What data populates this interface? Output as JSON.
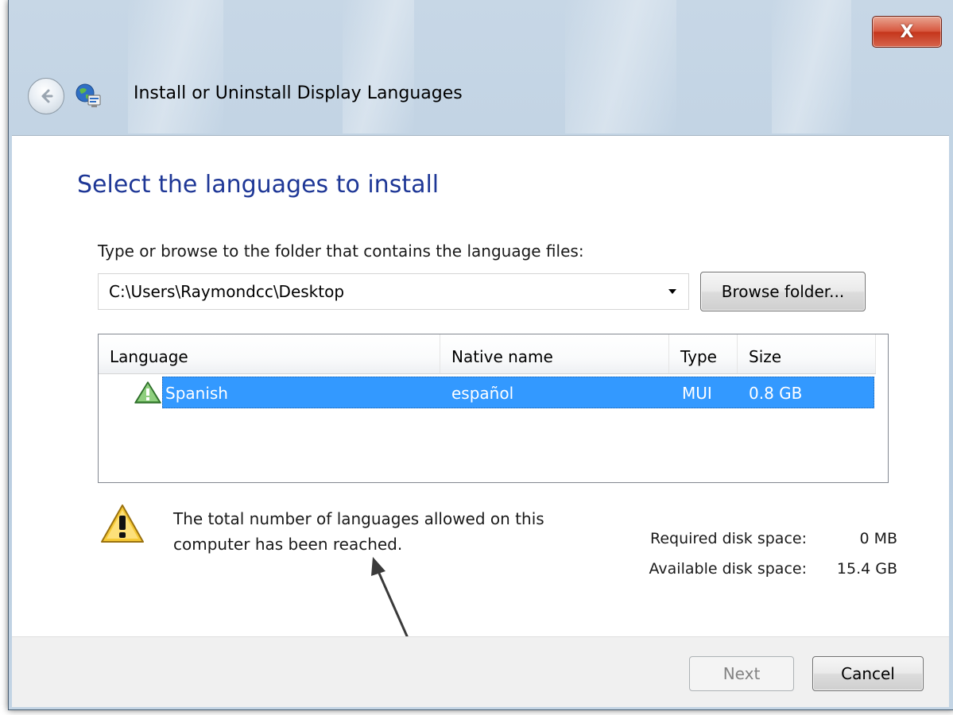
{
  "window": {
    "title": "Install or Uninstall Display Languages",
    "close_glyph": "X",
    "back_icon": "back-arrow-icon",
    "app_icon": "globe-language-icon"
  },
  "page": {
    "heading": "Select the languages to install",
    "folder_label": "Type or browse to the folder that contains the language files:",
    "folder_path": "C:\\Users\\Raymondcc\\Desktop",
    "browse_label": "Browse folder..."
  },
  "language_list": {
    "columns": [
      "Language",
      "Native name",
      "Type",
      "Size"
    ],
    "rows": [
      {
        "language": "Spanish",
        "native_name": "español",
        "type": "MUI",
        "size": "0.8 GB",
        "status_icon": "warning-icon",
        "selected": true
      }
    ]
  },
  "warning": {
    "icon": "warning-icon",
    "message": "The total number of languages allowed on this computer has been reached."
  },
  "disk": {
    "required_label": "Required disk space:",
    "required_value": "0 MB",
    "available_label": "Available disk space:",
    "available_value": "15.4 GB"
  },
  "footer": {
    "next_label": "Next",
    "next_enabled": false,
    "cancel_label": "Cancel"
  },
  "colors": {
    "heading": "#1e3796",
    "selection": "#3399ff",
    "close_button": "#c5361c"
  }
}
